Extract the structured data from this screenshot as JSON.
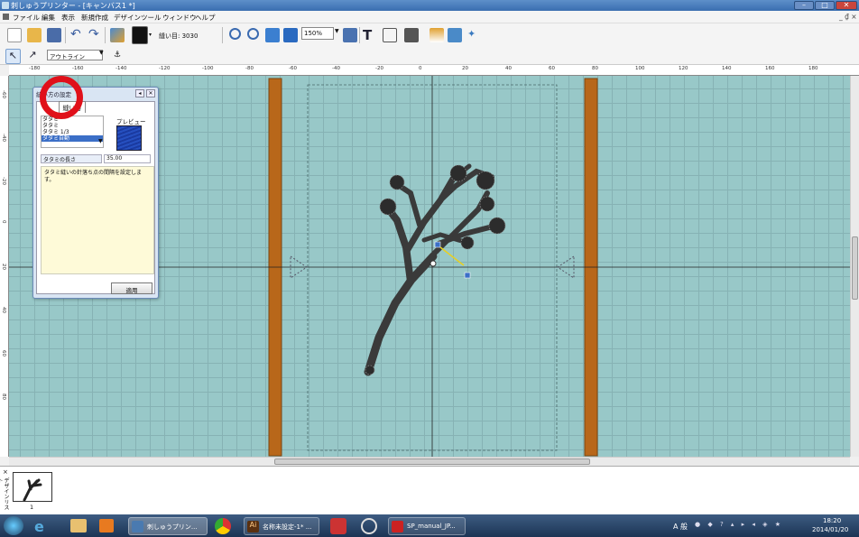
{
  "window": {
    "title": "刺しゅうプリンター - [キャンバス1 *]"
  },
  "menu": [
    "ファイル",
    "編集",
    "表示",
    "新規作成",
    "デザイン",
    "ツール",
    "ウィンドウ",
    "ヘルプ"
  ],
  "toolbar": {
    "stitch_count_label": "縫い目: 3030",
    "zoom_value": "150%"
  },
  "toolbar2": {
    "mode_value": "アウトライン"
  },
  "rulers": {
    "h_ticks": [
      "-180",
      "-160",
      "-140",
      "-120",
      "-100",
      "-80",
      "-60",
      "-40",
      "-20",
      "0",
      "20",
      "40",
      "60",
      "80",
      "100",
      "120",
      "140",
      "160",
      "180"
    ],
    "v_ticks": [
      "-60",
      "-40",
      "-20",
      "0",
      "20",
      "40",
      "60",
      "80"
    ]
  },
  "dialog": {
    "title": "縫い方の設定",
    "tab_label": "縫い方",
    "list_items": [
      "タタミ",
      "タタミ",
      "タタミ 1/3",
      "タタミ自動"
    ],
    "selected_item": "タタミ自動",
    "preview_label": "プレビュー",
    "length_label": "タタミの長さ",
    "length_value": "35.00",
    "description": "タタミ縫いの針落ち点の間隔を設定します。",
    "apply_label": "適用"
  },
  "filmstrip": {
    "side_label": "デザインリスト",
    "thumb_number": "1"
  },
  "taskbar": {
    "tasks": [
      "刺しゅうプリン...",
      "名称未設定-1* ...",
      "SP_manual_JP..."
    ],
    "tray_text": "A 般",
    "time": "18:20",
    "date": "2014/01/20"
  },
  "colors": {
    "accent_red": "#e0101a",
    "grid": "#98c8c8",
    "border_orange": "#b8671a",
    "highlight": "#3b6fc7"
  }
}
